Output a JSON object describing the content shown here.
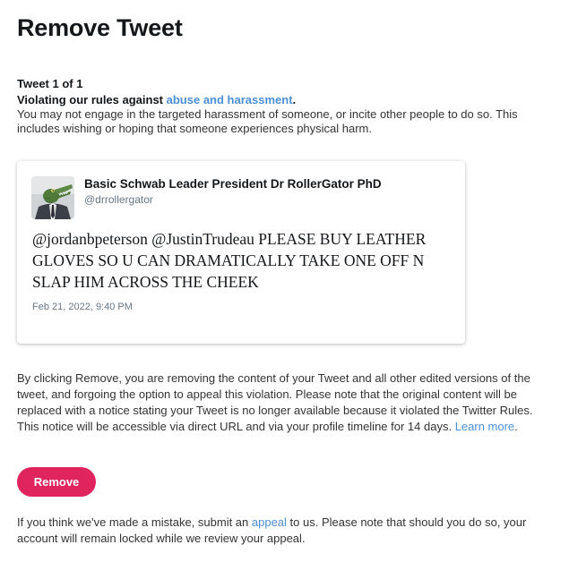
{
  "page": {
    "title": "Remove Tweet"
  },
  "violation": {
    "count_label": "Tweet 1 of 1",
    "headline_prefix": "Violating our rules against ",
    "headline_link": "abuse and harassment",
    "headline_suffix": ".",
    "description": "You may not engage in the targeted harassment of someone, or incite other people to do so. This includes wishing or hoping that someone experiences physical harm."
  },
  "tweet": {
    "author_name": "Basic Schwab Leader President Dr RollerGator PhD",
    "author_handle": "@drrollergator",
    "text": "@jordanbpeterson @JustinTrudeau PLEASE BUY LEATHER GLOVES SO U CAN DRAMATICALLY TAKE ONE OFF N SLAP HIM ACROSS THE CHEEK",
    "date": "Feb 21, 2022, 9:40 PM"
  },
  "notice": {
    "text": "By clicking Remove, you are removing the content of your Tweet and all other edited versions of the tweet, and forgoing the option to appeal this violation. Please note that the original content will be replaced with a notice stating your Tweet is no longer available because it violated the Twitter Rules. This notice will be accessible via direct URL and via your profile timeline for 14 days. ",
    "learn_more": "Learn more",
    "suffix": "."
  },
  "actions": {
    "remove_label": "Remove"
  },
  "appeal": {
    "prefix": "If you think we've made a mistake, submit an ",
    "link": "appeal",
    "suffix": " to us. Please note that should you do so, your account will remain locked while we review your appeal."
  },
  "colors": {
    "accent_link": "#4a90d6",
    "remove_button": "#e0245e"
  }
}
